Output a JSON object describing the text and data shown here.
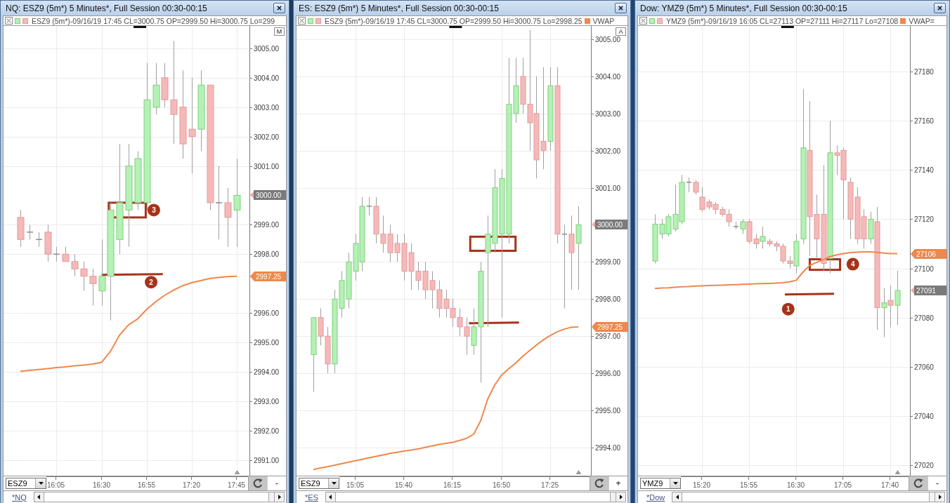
{
  "windows": [
    {
      "title": "NQ: ESZ9 (5m*) 5 Minutes*, Full Session 00:30-00:15",
      "legend": {
        "text": "ESZ9 (5m*)-09/16/19 17:45 CL=3000.75 OP=2999.50 Hi=3000.75 Lo=299"
      },
      "scale_button": "M",
      "chart_data": {
        "type": "candlestick",
        "grid": true,
        "categories": [
          null,
          null,
          null,
          null,
          "16:05",
          null,
          null,
          null,
          null,
          "16:30",
          null,
          null,
          null,
          null,
          "16:55",
          null,
          null,
          null,
          null,
          "17:20",
          null,
          null,
          null,
          null,
          "17:45"
        ],
        "ohlc": [
          [
            2999.25,
            2999.5,
            2998.25,
            2998.5
          ],
          [
            2998.75,
            2999.0,
            2998.5,
            2998.75
          ],
          [
            2998.5,
            2998.75,
            2998.25,
            2998.5
          ],
          [
            2998.75,
            2999.0,
            2997.75,
            2998.0
          ],
          [
            2998.0,
            2998.25,
            2997.75,
            2998.0
          ],
          [
            2998.0,
            2998.25,
            2997.75,
            2997.75
          ],
          [
            2997.75,
            2998.0,
            2997.25,
            2997.5
          ],
          [
            2997.5,
            2997.75,
            2996.75,
            2997.25
          ],
          [
            2997.25,
            2997.5,
            2996.25,
            2997.0
          ],
          [
            2996.75,
            2998.5,
            2996.25,
            2997.25
          ],
          [
            2997.25,
            2999.75,
            2995.75,
            2999.5
          ],
          [
            2998.5,
            3001.75,
            2998.0,
            2999.75
          ],
          [
            2999.5,
            3001.75,
            2998.25,
            3001.0
          ],
          [
            2999.75,
            3001.5,
            2999.5,
            3001.25
          ],
          [
            2999.75,
            3004.5,
            2999.5,
            3003.25
          ],
          [
            3003.0,
            3004.5,
            3002.75,
            3003.75
          ],
          [
            3004.0,
            3004.5,
            3003.0,
            3003.25
          ],
          [
            3003.25,
            3005.25,
            3001.75,
            3002.75
          ],
          [
            3003.0,
            3004.25,
            3001.25,
            3001.75
          ],
          [
            3002.25,
            3004.0,
            3000.75,
            3002.0
          ],
          [
            3002.25,
            3004.25,
            3001.5,
            3003.75
          ],
          [
            3003.75,
            3003.75,
            2999.5,
            2999.75
          ],
          [
            2999.75,
            3001.0,
            2998.5,
            2999.75
          ],
          [
            2999.75,
            3000.25,
            2998.25,
            2999.25
          ],
          [
            2999.5,
            3001.25,
            2998.25,
            3000.0
          ]
        ],
        "series": [
          {
            "type": "line",
            "color": "#f0874a",
            "values": [
              2994.02,
              2994.05,
              2994.08,
              2994.11,
              2994.14,
              2994.17,
              2994.2,
              2994.23,
              2994.26,
              2994.32,
              2994.7,
              2995.25,
              2995.6,
              2995.8,
              2996.12,
              2996.38,
              2996.6,
              2996.78,
              2996.93,
              2997.03,
              2997.1,
              2997.17,
              2997.21,
              2997.24,
              2997.25
            ]
          }
        ],
        "ylim": [
          2990.47,
          3005.76
        ],
        "yticks": [
          {
            "value": 3005,
            "label": "3005.00"
          },
          {
            "value": 3004,
            "label": "3004.00"
          },
          {
            "value": 3003,
            "label": "3003.00"
          },
          {
            "value": 3002,
            "label": "3002.00"
          },
          {
            "value": 3001,
            "label": "3001.00"
          },
          {
            "value": 2999,
            "label": "2999.00"
          },
          {
            "value": 2998,
            "label": "2998.00"
          },
          {
            "value": 2996,
            "label": "2996.00"
          },
          {
            "value": 2995,
            "label": "2995.00"
          },
          {
            "value": 2994,
            "label": "2994.00"
          },
          {
            "value": 2993,
            "label": "2993.00"
          },
          {
            "value": 2992,
            "label": "2992.00"
          },
          {
            "value": 2991,
            "label": "2991.00"
          }
        ],
        "annotations": [
          "3",
          "2"
        ]
      },
      "price_labels": [
        {
          "kind": "last",
          "text": "3000.00"
        },
        {
          "kind": "vwap",
          "text": "2997.25"
        }
      ],
      "symbol": "ESZ9",
      "zoom_button": "-",
      "sheet_tab": "*NQ"
    },
    {
      "title": "ES: ESZ9 (5m*) 5 Minutes*, Full Session 00:30-00:15",
      "legend": {
        "text": "ESZ9 (5m*)-09/16/19 17:45 CL=3000.75 OP=2999.50 Hi=3000.75 Lo=2998.25",
        "study_label": "VWAP"
      },
      "scale_button": "A",
      "chart_data": {
        "type": "candlestick",
        "grid": true,
        "categories": [
          null,
          null,
          null,
          null,
          null,
          null,
          "15:05",
          null,
          null,
          null,
          null,
          null,
          null,
          "15:40",
          null,
          null,
          null,
          null,
          null,
          null,
          "16:15",
          null,
          null,
          null,
          null,
          null,
          null,
          "16:50",
          null,
          null,
          null,
          null,
          null,
          null,
          "17:25",
          null,
          null,
          null,
          null
        ],
        "ohlc": [
          [
            2996.5,
            2997.5,
            2995.5,
            2997.5
          ],
          [
            2997.5,
            2997.75,
            2996.75,
            2997.0
          ],
          [
            2997.0,
            2997.25,
            2996.0,
            2996.25
          ],
          [
            2996.25,
            2998.25,
            2996.0,
            2998.0
          ],
          [
            2997.75,
            2998.75,
            2997.5,
            2998.5
          ],
          [
            2998.0,
            2999.25,
            2997.75,
            2999.0
          ],
          [
            2998.75,
            2999.75,
            2998.5,
            2999.5
          ],
          [
            2999.0,
            3000.75,
            2998.75,
            3000.5
          ],
          [
            3000.5,
            3000.75,
            3000.25,
            3000.5
          ],
          [
            3000.5,
            3000.75,
            2999.5,
            2999.75
          ],
          [
            2999.75,
            3000.25,
            2999.25,
            2999.5
          ],
          [
            2999.75,
            3000.0,
            2999.0,
            2999.25
          ],
          [
            2999.5,
            2999.75,
            2999.0,
            2999.25
          ],
          [
            2999.5,
            2999.75,
            2998.5,
            2998.75
          ],
          [
            2999.25,
            2999.5,
            2998.25,
            2998.75
          ],
          [
            2998.75,
            2999.0,
            2998.25,
            2998.5
          ],
          [
            2998.75,
            2999.0,
            2998.0,
            2998.25
          ],
          [
            2998.5,
            2998.75,
            2997.75,
            2998.25
          ],
          [
            2998.25,
            2998.5,
            2997.5,
            2997.75
          ],
          [
            2998.0,
            2998.25,
            2997.5,
            2997.75
          ],
          [
            2997.75,
            2998.0,
            2997.25,
            2997.5
          ],
          [
            2997.5,
            2997.75,
            2997.0,
            2997.25
          ],
          [
            2997.25,
            2997.5,
            2996.5,
            2997.0
          ],
          [
            2996.75,
            2997.75,
            2996.5,
            2997.25
          ],
          [
            2997.25,
            2999.0,
            2995.75,
            2998.75
          ],
          [
            2999.25,
            3000.25,
            2997.25,
            2999.75
          ],
          [
            2999.5,
            3001.5,
            2999.25,
            3001.0
          ],
          [
            2999.75,
            3001.5,
            2997.5,
            3001.25
          ],
          [
            2999.75,
            3004.5,
            2999.5,
            3003.25
          ],
          [
            3003.0,
            3004.5,
            3002.75,
            3003.75
          ],
          [
            3004.0,
            3004.5,
            3003.0,
            3003.25
          ],
          [
            3003.25,
            3005.25,
            3002.0,
            3002.75
          ],
          [
            3003.0,
            3004.0,
            3001.25,
            3001.75
          ],
          [
            3002.25,
            3004.25,
            3001.5,
            3002.0
          ],
          [
            3002.25,
            3004.25,
            3002.0,
            3003.75
          ],
          [
            3003.75,
            3004.25,
            2999.5,
            2999.75
          ],
          [
            2999.75,
            3000.0,
            2997.75,
            2999.75
          ],
          [
            2999.75,
            3000.25,
            2998.25,
            2999.25
          ],
          [
            2999.5,
            3000.5,
            2998.25,
            3000.0
          ]
        ],
        "series": [
          {
            "type": "line",
            "color": "#f0874a",
            "values": [
              2993.4,
              2993.45,
              2993.48,
              2993.52,
              2993.56,
              2993.6,
              2993.64,
              2993.68,
              2993.72,
              2993.76,
              2993.8,
              2993.84,
              2993.87,
              2993.9,
              2993.93,
              2993.96,
              2994.0,
              2994.04,
              2994.08,
              2994.11,
              2994.14,
              2994.19,
              2994.25,
              2994.36,
              2994.72,
              2995.3,
              2995.68,
              2995.95,
              2996.12,
              2996.27,
              2996.45,
              2996.61,
              2996.76,
              2996.9,
              2997.02,
              2997.12,
              2997.19,
              2997.24,
              2997.25
            ]
          }
        ],
        "ylim": [
          2993.24,
          3005.36
        ],
        "yticks": [
          {
            "value": 3005,
            "label": "3005.00"
          },
          {
            "value": 3004,
            "label": "3004.00"
          },
          {
            "value": 3003,
            "label": "3003.00"
          },
          {
            "value": 3002,
            "label": "3002.00"
          },
          {
            "value": 3001,
            "label": "3001.00"
          },
          {
            "value": 2999,
            "label": "2999.00"
          },
          {
            "value": 2998,
            "label": "2998.00"
          },
          {
            "value": 2997,
            "label": "2997.00"
          },
          {
            "value": 2996,
            "label": "2996.00"
          },
          {
            "value": 2995,
            "label": "2995.00"
          },
          {
            "value": 2994,
            "label": "2994.00"
          }
        ]
      },
      "price_labels": [
        {
          "kind": "last",
          "text": "3000.00"
        },
        {
          "kind": "vwap",
          "text": "2997.25"
        }
      ],
      "symbol": "ESZ9",
      "zoom_button": "+",
      "sheet_tab": "*ES"
    },
    {
      "title": "Dow: YMZ9 (5m*) 5 Minutes*, Full Session 00:30-00:15",
      "legend": {
        "text": "YMZ9 (5m*)-09/16/19 16:05 CL=27113 OP=27111 Hi=27117 Lo=27108",
        "study_label": "VWAP="
      },
      "chart_data": {
        "type": "candlestick",
        "grid": true,
        "categories": [
          null,
          null,
          null,
          null,
          null,
          null,
          null,
          "15:20",
          null,
          null,
          null,
          null,
          null,
          null,
          "15:55",
          null,
          null,
          null,
          null,
          null,
          null,
          "16:30",
          null,
          null,
          null,
          null,
          null,
          null,
          "17:05",
          null,
          null,
          null,
          null,
          null,
          null,
          "17:40",
          null
        ],
        "ohlc": [
          [
            27103,
            27122,
            27102,
            27118
          ],
          [
            27114,
            27120,
            27112,
            27118
          ],
          [
            27114,
            27122,
            27113,
            27121
          ],
          [
            27116,
            27134,
            27115,
            27122
          ],
          [
            27119,
            27138,
            27118,
            27135
          ],
          [
            27135,
            27137,
            27131,
            27135
          ],
          [
            27135,
            27136,
            27130,
            27131
          ],
          [
            27129,
            27133,
            27123,
            27124
          ],
          [
            27127,
            27128,
            27124,
            27125
          ],
          [
            27126,
            27127,
            27122,
            27124
          ],
          [
            27124,
            27125,
            27121,
            27122
          ],
          [
            27122,
            27124,
            27117,
            27119
          ],
          [
            27117,
            27119,
            27116,
            27117
          ],
          [
            27116,
            27120,
            27114,
            27119
          ],
          [
            27119,
            27120,
            27110,
            27111
          ],
          [
            27112,
            27114,
            27108,
            27110
          ],
          [
            27111,
            27117,
            27108,
            27113
          ],
          [
            27111,
            27112,
            27109,
            27110
          ],
          [
            27110,
            27111,
            27107,
            27109
          ],
          [
            27109,
            27110,
            27102,
            27103
          ],
          [
            27103,
            27105,
            27100,
            27102
          ],
          [
            27101,
            27114,
            27098,
            27111
          ],
          [
            27112,
            27173,
            27110,
            27149
          ],
          [
            27148,
            27168,
            27105,
            27121
          ],
          [
            27122,
            27130,
            27104,
            27112
          ],
          [
            27122,
            27142,
            27099,
            27102
          ],
          [
            27104,
            27160,
            27098,
            27147
          ],
          [
            27147,
            27150,
            27138,
            27146
          ],
          [
            27148,
            27149,
            27120,
            27136
          ],
          [
            27135,
            27137,
            27112,
            27120
          ],
          [
            27129,
            27133,
            27110,
            27112
          ],
          [
            27121,
            27124,
            27108,
            27112
          ],
          [
            27112,
            27123,
            27110,
            27120
          ],
          [
            27119,
            27125,
            27075,
            27084
          ],
          [
            27084,
            27092,
            27072,
            27086
          ],
          [
            27087,
            27093,
            27076,
            27085
          ],
          [
            27085,
            27099,
            27077,
            27091
          ]
        ],
        "series": [
          {
            "type": "line",
            "color": "#f0874a",
            "values": [
              27091.8,
              27092,
              27092.1,
              27092.3,
              27092.5,
              27092.6,
              27092.8,
              27092.9,
              27093,
              27093.1,
              27093.2,
              27093.3,
              27093.4,
              27093.5,
              27093.6,
              27093.7,
              27093.8,
              27093.9,
              27094,
              27094.2,
              27094.5,
              27095.2,
              27098.5,
              27101.2,
              27102.4,
              27103.5,
              27104.8,
              27105.5,
              27106,
              27106.4,
              27106.6,
              27106.7,
              27106.7,
              27106.5,
              27106.2,
              27106,
              27106
            ]
          }
        ],
        "ylim": [
          27015.7,
          27198.6
        ],
        "yticks": [
          27180,
          27160,
          27140,
          27120,
          27100,
          27080,
          27060,
          27040,
          27020
        ],
        "annotations": [
          "4",
          "1"
        ]
      },
      "price_labels": [
        {
          "kind": "vwap",
          "text": "27106"
        },
        {
          "kind": "last",
          "text": "27091"
        }
      ],
      "symbol": "YMZ9",
      "zoom_button": "-",
      "sheet_tab": "*Dow"
    }
  ]
}
